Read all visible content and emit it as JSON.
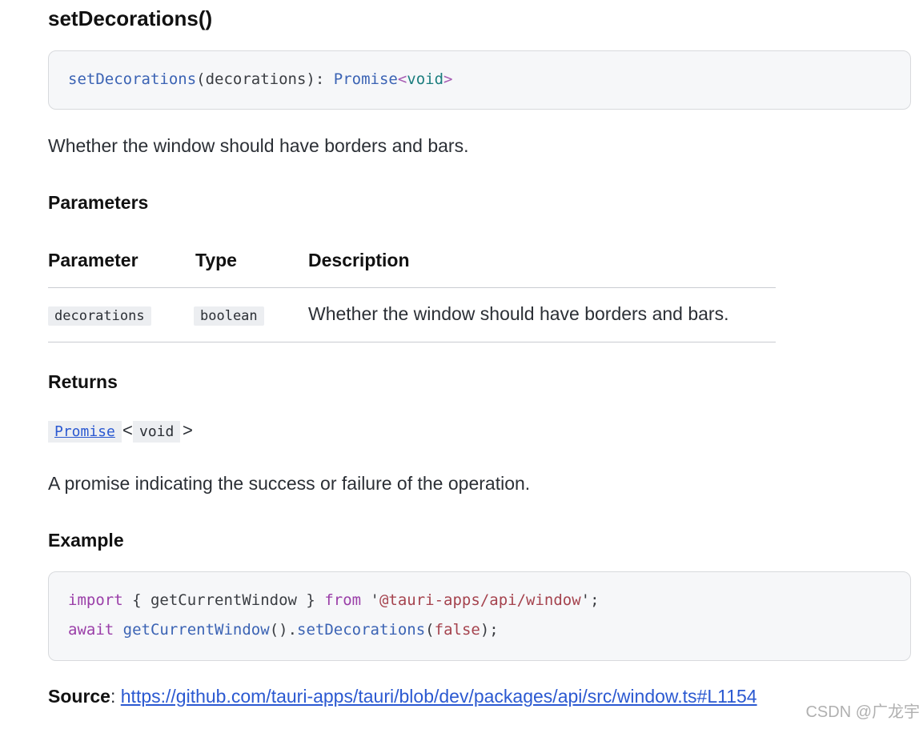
{
  "heading": "setDecorations()",
  "signature": {
    "fn": "setDecorations",
    "params": "(decorations): ",
    "type": "Promise",
    "lt": "<",
    "inner": "void",
    "gt": ">"
  },
  "description": "Whether the window should have borders and bars.",
  "parameters": {
    "heading": "Parameters",
    "headers": [
      "Parameter",
      "Type",
      "Description"
    ],
    "rows": [
      {
        "name": "decorations",
        "type": "boolean",
        "description": "Whether the window should have borders and bars."
      }
    ]
  },
  "returns": {
    "heading": "Returns",
    "type_link": "Promise",
    "lt": "<",
    "inner": "void",
    "gt": ">",
    "description": "A promise indicating the success or failure of the operation."
  },
  "example": {
    "heading": "Example",
    "line1": {
      "kw_import": "import",
      "braces": " { getCurrentWindow } ",
      "kw_from": "from",
      "space": " ",
      "q1": "'",
      "module": "@tauri-apps/api/window",
      "q2": "'",
      "semi": ";"
    },
    "line2": {
      "kw_await": "await",
      "space": " ",
      "call1": "getCurrentWindow",
      "parens": "().",
      "call2": "setDecorations",
      "open": "(",
      "arg": "false",
      "close": ");"
    }
  },
  "source": {
    "label": "Source",
    "colon": ": ",
    "url": "https://github.com/tauri-apps/tauri/blob/dev/packages/api/src/window.ts#L1154"
  },
  "watermark": "CSDN @广龙宇"
}
